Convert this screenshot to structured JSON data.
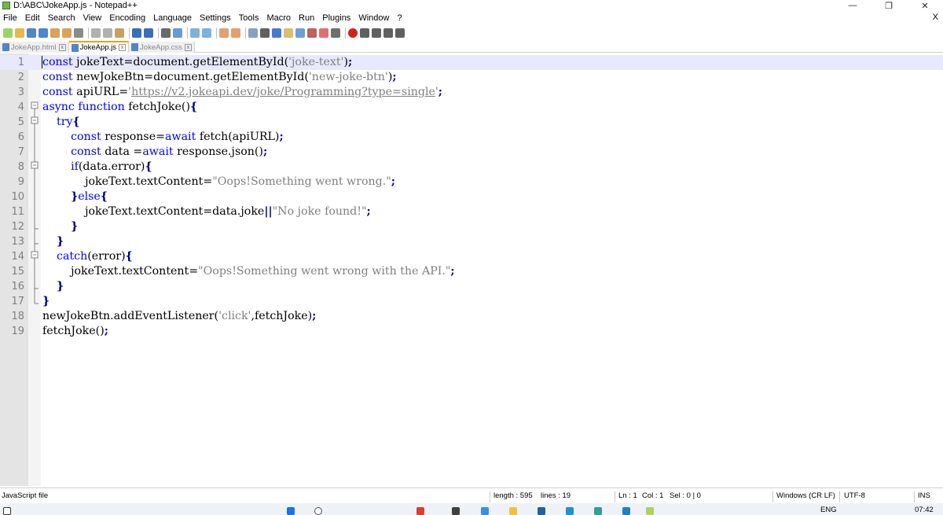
{
  "window": {
    "title": "D:\\ABC\\JokeApp.js - Notepad++",
    "minimize_glyph": "—",
    "restore_glyph": "❐",
    "close_glyph": "✕"
  },
  "menu": {
    "items": [
      "File",
      "Edit",
      "Search",
      "View",
      "Encoding",
      "Language",
      "Settings",
      "Tools",
      "Macro",
      "Run",
      "Plugins",
      "Window",
      "?"
    ],
    "close_glyph": "X"
  },
  "tabs": [
    {
      "label": "JokeApp.html",
      "close": "x"
    },
    {
      "label": "JokeApp.js",
      "close": "x"
    },
    {
      "label": "JokeApp.css",
      "close": "x"
    }
  ],
  "editor": {
    "line_numbers": [
      "1",
      "2",
      "3",
      "4",
      "5",
      "6",
      "7",
      "8",
      "9",
      "10",
      "11",
      "12",
      "13",
      "14",
      "15",
      "16",
      "17",
      "18",
      "19"
    ],
    "current_line": 1
  },
  "status": {
    "language": "JavaScript file",
    "length": "length : 595",
    "lines": "lines : 19",
    "ln": "Ln : 1",
    "col": "Col : 1",
    "sel": "Sel : 0 | 0",
    "eol": "Windows (CR LF)",
    "encoding": "UTF-8",
    "mode": "INS"
  },
  "taskbar": {
    "lang": "ENG",
    "time": "07:42"
  },
  "colors": {
    "keyword": "#0000ff",
    "string": "#808080",
    "operator": "#000080",
    "gutter": "#e4e4e4",
    "current_line": "#e8e8ff",
    "active_tab_accent": "#f4a000"
  }
}
